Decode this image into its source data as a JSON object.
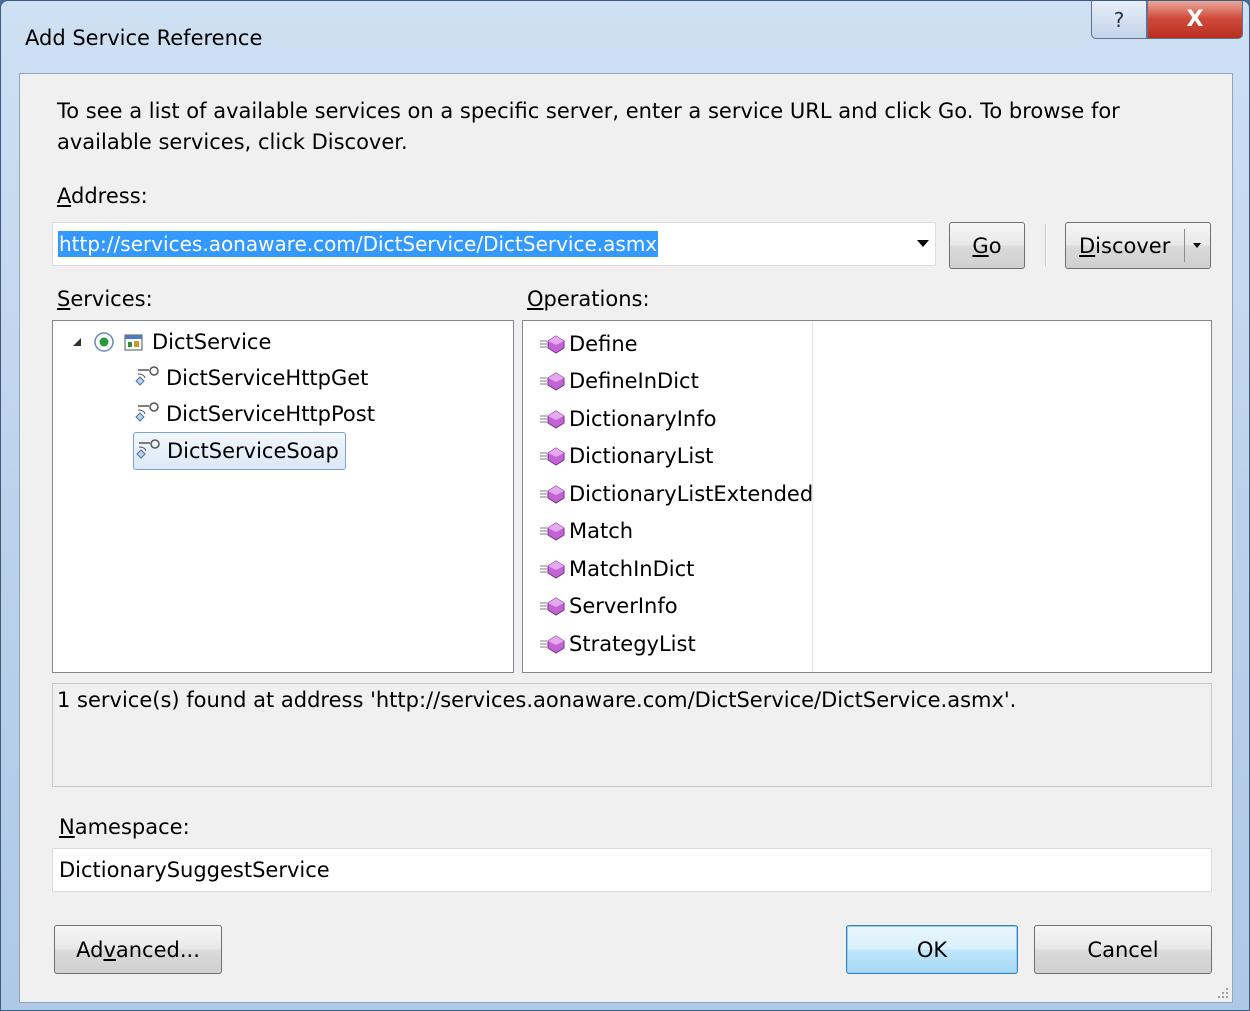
{
  "window": {
    "title": "Add Service Reference",
    "help_glyph": "?",
    "close_glyph": "X"
  },
  "instructions": "To see a list of available services on a specific server, enter a service URL and click Go. To browse for available services, click Discover.",
  "address": {
    "label_accel": "A",
    "label_rest": "ddress:",
    "value": "http://services.aonaware.com/DictService/DictService.asmx",
    "go_accel": "G",
    "go_rest": "o",
    "discover_accel": "D",
    "discover_rest": "iscover"
  },
  "services": {
    "label_accel": "S",
    "label_rest": "ervices:",
    "root": "DictService",
    "children": [
      "DictServiceHttpGet",
      "DictServiceHttpPost",
      "DictServiceSoap"
    ],
    "selected": "DictServiceSoap"
  },
  "operations": {
    "label_accel": "O",
    "label_rest": "perations:",
    "items": [
      "Define",
      "DefineInDict",
      "DictionaryInfo",
      "DictionaryList",
      "DictionaryListExtended",
      "Match",
      "MatchInDict",
      "ServerInfo",
      "StrategyList"
    ]
  },
  "status_message": "1 service(s) found at address 'http://services.aonaware.com/DictService/DictService.asmx'.",
  "namespace": {
    "label_accel": "N",
    "label_rest": "amespace:",
    "value": "DictionarySuggestService"
  },
  "buttons": {
    "advanced_pre": "Ad",
    "advanced_accel": "v",
    "advanced_post": "anced...",
    "ok": "OK",
    "cancel": "Cancel"
  },
  "icons": {
    "expander": "triangle-expanded-icon",
    "service_root": "service-reference-icon",
    "endpoint": "endpoint-icon",
    "operation": "method-icon"
  },
  "colors": {
    "selection": "#3399ff",
    "close_button": "#c84333",
    "tree_selection_border": "#7da2ce"
  }
}
